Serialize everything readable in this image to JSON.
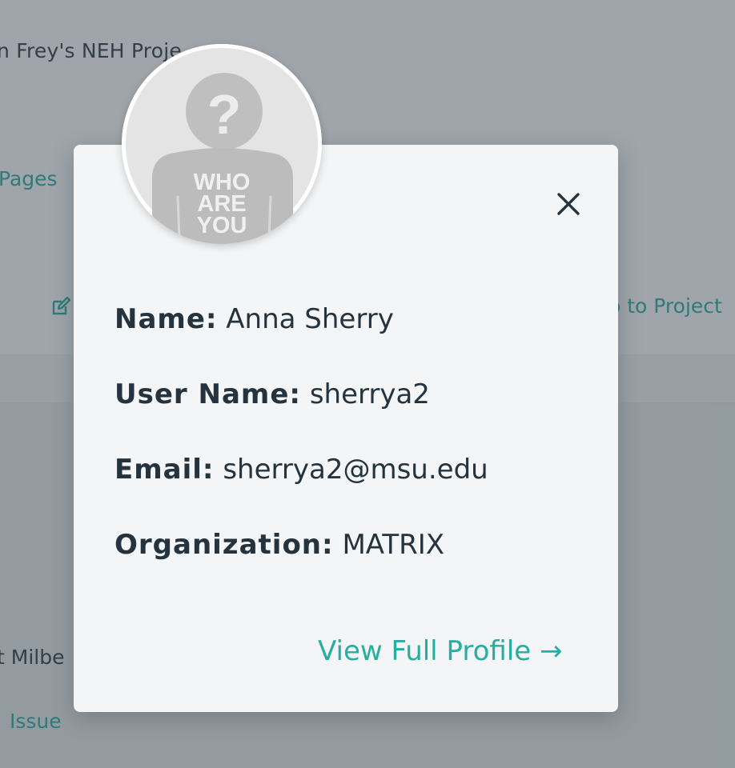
{
  "background": {
    "project_title": "n Frey's NEH Proje",
    "pages_link": "Pages",
    "goto_link": "o to Project",
    "person_name": "t Milbe",
    "issue_link": "Issue"
  },
  "modal": {
    "close_icon": "close-icon",
    "avatar": {
      "caption_lines": [
        "WHO",
        "ARE",
        "YOU"
      ]
    },
    "fields": {
      "name_label": "Name:",
      "name_value": "Anna Sherry",
      "username_label": "User Name:",
      "username_value": "sherrya2",
      "email_label": "Email:",
      "email_value": "sherrya2@msu.edu",
      "organization_label": "Organization:",
      "organization_value": "MATRIX"
    },
    "view_profile_label": "View Full Profile →"
  },
  "colors": {
    "accent": "#27aea1",
    "text": "#24333d",
    "modal_bg": "#f3f5f6"
  }
}
